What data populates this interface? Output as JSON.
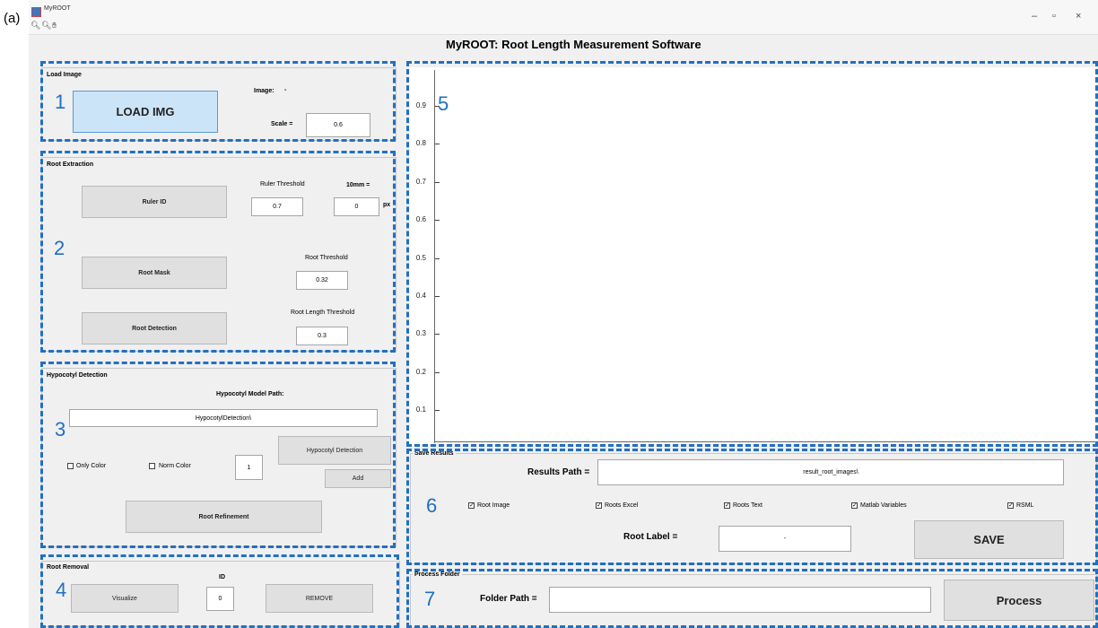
{
  "figure_label": "(a)",
  "window": {
    "title": "MyROOT",
    "controls": {
      "minimize": "–",
      "maximize": "▫",
      "close": "×"
    },
    "toolbar_icons": [
      "zoom-in-icon",
      "zoom-out-icon",
      "pan-hand-icon"
    ]
  },
  "heading": "MyROOT: Root Length Measurement Software",
  "markers": {
    "m1": "1",
    "m2": "2",
    "m3": "3",
    "m4": "4",
    "m5": "5",
    "m6": "6",
    "m7": "7"
  },
  "load_image": {
    "title": "Load Image",
    "button": "LOAD IMG",
    "image_label": "Image:",
    "image_value": "-",
    "scale_label": "Scale =",
    "scale_value": "0.6"
  },
  "root_extraction": {
    "title": "Root Extraction",
    "ruler_button": "Ruler ID",
    "ruler_threshold_label": "Ruler Threshold",
    "ruler_threshold_value": "0.7",
    "mm_label": "10mm =",
    "mm_value": "0",
    "px_label": "px",
    "mask_button": "Root Mask",
    "root_threshold_label": "Root Threshold",
    "root_threshold_value": "0.32",
    "detection_button": "Root Detection",
    "length_threshold_label": "Root Length Threshold",
    "length_threshold_value": "0.3"
  },
  "hypocotyl": {
    "title": "Hypocotyl Detection",
    "model_path_label": "Hypocotyl Model Path:",
    "model_path_value": "HypocotylDetection\\",
    "detect_button": "Hypocotyl Detection",
    "only_color_label": "Only Color",
    "only_color_checked": false,
    "norm_color_label": "Norm Color",
    "norm_color_checked": false,
    "count_value": "1",
    "add_button": "Add",
    "refine_button": "Root Refinement"
  },
  "root_removal": {
    "title": "Root Removal",
    "visualize_button": "Visualize",
    "id_label": "ID",
    "id_value": "0",
    "remove_button": "REMOVE"
  },
  "plot": {
    "y_ticks": [
      "0.9",
      "0.8",
      "0.7",
      "0.6",
      "0.5",
      "0.4",
      "0.3",
      "0.2",
      "0.1"
    ]
  },
  "save_results": {
    "title": "Save Results",
    "path_label": "Results Path =",
    "path_value": "result_root_images\\",
    "options": [
      {
        "label": "Root Image",
        "checked": true
      },
      {
        "label": "Roots Excel",
        "checked": true
      },
      {
        "label": "Roots Text",
        "checked": true
      },
      {
        "label": "Matlab Variables",
        "checked": true
      },
      {
        "label": "RSML",
        "checked": true
      }
    ],
    "label_label": "Root Label =",
    "label_value": "-",
    "save_button": "SAVE"
  },
  "process_folder": {
    "title": "Process Folder",
    "folder_label": "Folder Path =",
    "folder_value": "",
    "process_button": "Process"
  },
  "colors": {
    "accent_dash": "#2270c0",
    "load_button": "#cce4f7",
    "background": "#f0f0f0"
  }
}
